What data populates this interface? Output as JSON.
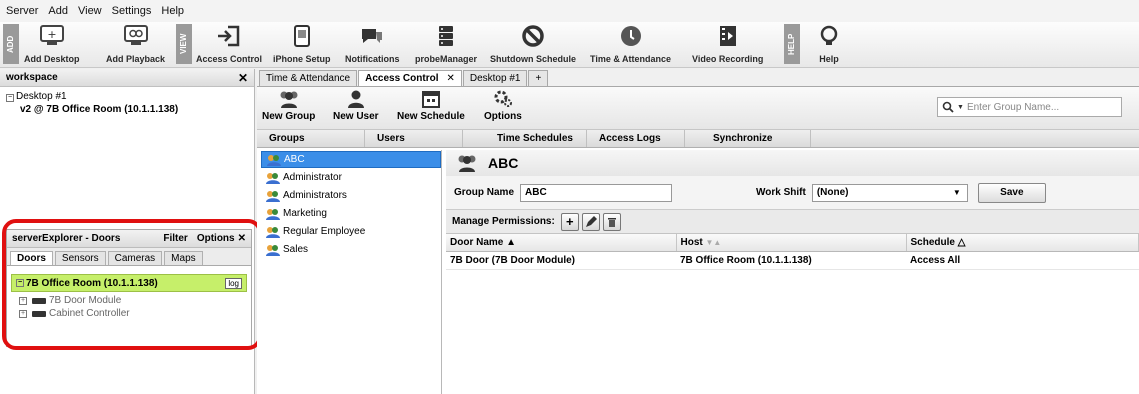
{
  "menu": [
    "Server",
    "Add",
    "View",
    "Settings",
    "Help"
  ],
  "toolbar": {
    "tags": [
      "ADD",
      "VIEW",
      "HELP"
    ],
    "buttons": [
      "Add Desktop",
      "Add Playback",
      "Access Control",
      "iPhone Setup",
      "Notifications",
      "probeManager",
      "Shutdown Schedule",
      "Time & Attendance",
      "Video Recording",
      "Help"
    ]
  },
  "workspace": {
    "title": "workspace",
    "close": "✕",
    "desktop": "Desktop #1",
    "stream": "v2 @ 7B Office Room (10.1.1.138)"
  },
  "server_explorer": {
    "title": "serverExplorer - Doors",
    "filter": "Filter",
    "options": "Options",
    "close": "✕",
    "tabs": [
      "Doors",
      "Sensors",
      "Cameras",
      "Maps"
    ],
    "room": "7B Office Room (10.1.1.138)",
    "log": "log",
    "items": [
      "7B Door Module",
      "Cabinet Controller"
    ]
  },
  "main_tabs": [
    "Time & Attendance",
    "Access Control",
    "Desktop #1",
    "+"
  ],
  "main_tabs_close": "✕",
  "access_toolbar": {
    "buttons": [
      "New Group",
      "New User",
      "New Schedule",
      "Options"
    ],
    "search_placeholder": "Enter Group Name..."
  },
  "section_tabs": [
    "Groups",
    "Users",
    "Time Schedules",
    "Access Logs",
    "Synchronize"
  ],
  "groups": [
    "ABC",
    "Administrator",
    "Administrators",
    "Marketing",
    "Regular Employee",
    "Sales"
  ],
  "detail": {
    "title": "ABC",
    "group_name_label": "Group Name",
    "group_name_value": "ABC",
    "work_shift_label": "Work Shift",
    "work_shift_value": "(None)",
    "save": "Save",
    "permissions_label": "Manage Permissions:",
    "columns": [
      "Door Name ▲",
      "Host",
      "Schedule △"
    ],
    "rows": [
      [
        "7B Door (7B Door Module)",
        "7B Office Room (10.1.1.138)",
        "Access All"
      ]
    ]
  },
  "colors": {
    "highlight": "#e01010",
    "selected_group": "#3b8ee8",
    "room_bg": "#c6ef6a"
  }
}
